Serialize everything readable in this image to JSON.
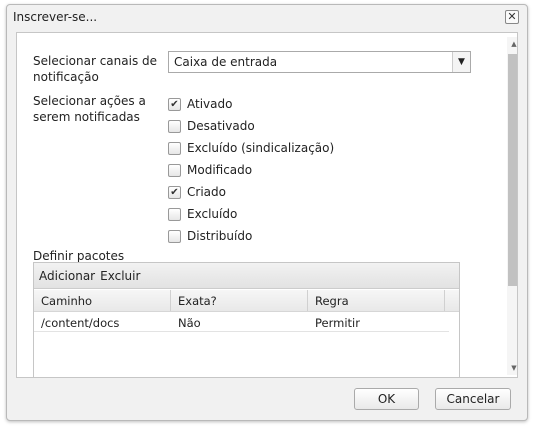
{
  "dialog": {
    "title": "Inscrever-se...",
    "close_icon": "close-icon"
  },
  "form": {
    "channels_label_1": "Selecionar canais de",
    "channels_label_2": "notificação",
    "channels_value": "Caixa de entrada",
    "actions_label_1": "Selecionar ações a",
    "actions_label_2": "serem notificadas",
    "actions": [
      {
        "label": "Ativado",
        "checked": true
      },
      {
        "label": "Desativado",
        "checked": false
      },
      {
        "label": "Excluído (sindicalização)",
        "checked": false
      },
      {
        "label": "Modificado",
        "checked": false
      },
      {
        "label": "Criado",
        "checked": true
      },
      {
        "label": "Excluído",
        "checked": false
      },
      {
        "label": "Distribuído",
        "checked": false
      }
    ],
    "packages_label": "Definir pacotes"
  },
  "grid": {
    "toolbar": {
      "add": "Adicionar",
      "delete": "Excluir"
    },
    "columns": [
      "Caminho",
      "Exata?",
      "Regra"
    ],
    "rows": [
      [
        "/content/docs",
        "Não",
        "Permitir"
      ]
    ]
  },
  "buttons": {
    "ok": "OK",
    "cancel": "Cancelar"
  }
}
